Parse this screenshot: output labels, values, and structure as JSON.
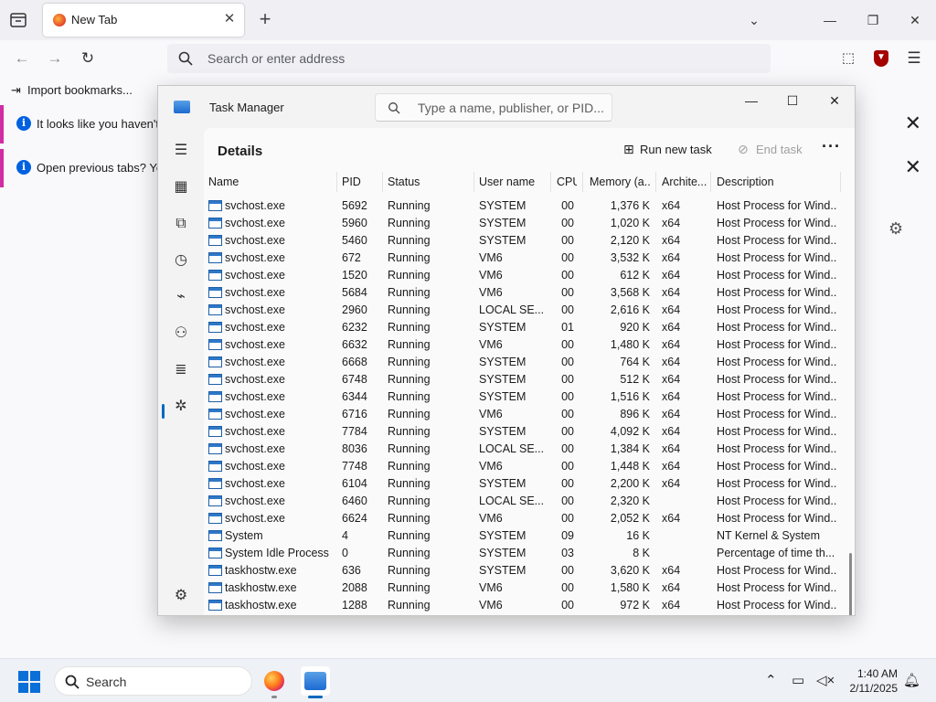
{
  "firefox": {
    "tab_title": "New Tab",
    "url_placeholder": "Search or enter address",
    "bookmark_import": "Import bookmarks...",
    "notice1": "It looks like you haven't s",
    "notice2": "Open previous tabs? You"
  },
  "taskmgr": {
    "app_title": "Task Manager",
    "search_placeholder": "Type a name, publisher, or PID...",
    "section_title": "Details",
    "run_new_task": "Run new task",
    "end_task": "End task",
    "columns": {
      "name": "Name",
      "pid": "PID",
      "status": "Status",
      "user": "User name",
      "cpu": "CPU",
      "mem": "Memory (a...",
      "arch": "Archite...",
      "desc": "Description"
    },
    "rows": [
      {
        "name": "svchost.exe",
        "pid": "5692",
        "status": "Running",
        "user": "SYSTEM",
        "cpu": "00",
        "mem": "1,376 K",
        "arch": "x64",
        "desc": "Host Process for Wind..."
      },
      {
        "name": "svchost.exe",
        "pid": "5960",
        "status": "Running",
        "user": "SYSTEM",
        "cpu": "00",
        "mem": "1,020 K",
        "arch": "x64",
        "desc": "Host Process for Wind..."
      },
      {
        "name": "svchost.exe",
        "pid": "5460",
        "status": "Running",
        "user": "SYSTEM",
        "cpu": "00",
        "mem": "2,120 K",
        "arch": "x64",
        "desc": "Host Process for Wind..."
      },
      {
        "name": "svchost.exe",
        "pid": "672",
        "status": "Running",
        "user": "VM6",
        "cpu": "00",
        "mem": "3,532 K",
        "arch": "x64",
        "desc": "Host Process for Wind..."
      },
      {
        "name": "svchost.exe",
        "pid": "1520",
        "status": "Running",
        "user": "VM6",
        "cpu": "00",
        "mem": "612 K",
        "arch": "x64",
        "desc": "Host Process for Wind..."
      },
      {
        "name": "svchost.exe",
        "pid": "5684",
        "status": "Running",
        "user": "VM6",
        "cpu": "00",
        "mem": "3,568 K",
        "arch": "x64",
        "desc": "Host Process for Wind..."
      },
      {
        "name": "svchost.exe",
        "pid": "2960",
        "status": "Running",
        "user": "LOCAL SE...",
        "cpu": "00",
        "mem": "2,616 K",
        "arch": "x64",
        "desc": "Host Process for Wind..."
      },
      {
        "name": "svchost.exe",
        "pid": "6232",
        "status": "Running",
        "user": "SYSTEM",
        "cpu": "01",
        "mem": "920 K",
        "arch": "x64",
        "desc": "Host Process for Wind..."
      },
      {
        "name": "svchost.exe",
        "pid": "6632",
        "status": "Running",
        "user": "VM6",
        "cpu": "00",
        "mem": "1,480 K",
        "arch": "x64",
        "desc": "Host Process for Wind..."
      },
      {
        "name": "svchost.exe",
        "pid": "6668",
        "status": "Running",
        "user": "SYSTEM",
        "cpu": "00",
        "mem": "764 K",
        "arch": "x64",
        "desc": "Host Process for Wind..."
      },
      {
        "name": "svchost.exe",
        "pid": "6748",
        "status": "Running",
        "user": "SYSTEM",
        "cpu": "00",
        "mem": "512 K",
        "arch": "x64",
        "desc": "Host Process for Wind..."
      },
      {
        "name": "svchost.exe",
        "pid": "6344",
        "status": "Running",
        "user": "SYSTEM",
        "cpu": "00",
        "mem": "1,516 K",
        "arch": "x64",
        "desc": "Host Process for Wind..."
      },
      {
        "name": "svchost.exe",
        "pid": "6716",
        "status": "Running",
        "user": "VM6",
        "cpu": "00",
        "mem": "896 K",
        "arch": "x64",
        "desc": "Host Process for Wind..."
      },
      {
        "name": "svchost.exe",
        "pid": "7784",
        "status": "Running",
        "user": "SYSTEM",
        "cpu": "00",
        "mem": "4,092 K",
        "arch": "x64",
        "desc": "Host Process for Wind..."
      },
      {
        "name": "svchost.exe",
        "pid": "8036",
        "status": "Running",
        "user": "LOCAL SE...",
        "cpu": "00",
        "mem": "1,384 K",
        "arch": "x64",
        "desc": "Host Process for Wind..."
      },
      {
        "name": "svchost.exe",
        "pid": "7748",
        "status": "Running",
        "user": "VM6",
        "cpu": "00",
        "mem": "1,448 K",
        "arch": "x64",
        "desc": "Host Process for Wind..."
      },
      {
        "name": "svchost.exe",
        "pid": "6104",
        "status": "Running",
        "user": "SYSTEM",
        "cpu": "00",
        "mem": "2,200 K",
        "arch": "x64",
        "desc": "Host Process for Wind..."
      },
      {
        "name": "svchost.exe",
        "pid": "6460",
        "status": "Running",
        "user": "LOCAL SE...",
        "cpu": "00",
        "mem": "2,320 K",
        "arch": "",
        "desc": "Host Process for Wind..."
      },
      {
        "name": "svchost.exe",
        "pid": "6624",
        "status": "Running",
        "user": "VM6",
        "cpu": "00",
        "mem": "2,052 K",
        "arch": "x64",
        "desc": "Host Process for Wind..."
      },
      {
        "name": "System",
        "pid": "4",
        "status": "Running",
        "user": "SYSTEM",
        "cpu": "09",
        "mem": "16 K",
        "arch": "",
        "desc": "NT Kernel & System"
      },
      {
        "name": "System Idle Process",
        "pid": "0",
        "status": "Running",
        "user": "SYSTEM",
        "cpu": "03",
        "mem": "8 K",
        "arch": "",
        "desc": "Percentage of time th..."
      },
      {
        "name": "taskhostw.exe",
        "pid": "636",
        "status": "Running",
        "user": "SYSTEM",
        "cpu": "00",
        "mem": "3,620 K",
        "arch": "x64",
        "desc": "Host Process for Wind..."
      },
      {
        "name": "taskhostw.exe",
        "pid": "2088",
        "status": "Running",
        "user": "VM6",
        "cpu": "00",
        "mem": "1,580 K",
        "arch": "x64",
        "desc": "Host Process for Wind..."
      },
      {
        "name": "taskhostw.exe",
        "pid": "1288",
        "status": "Running",
        "user": "VM6",
        "cpu": "00",
        "mem": "972 K",
        "arch": "x64",
        "desc": "Host Process for Wind..."
      }
    ]
  },
  "taskbar": {
    "search_placeholder": "Search",
    "time": "1:40 AM",
    "date": "2/11/2025"
  },
  "colors": {
    "accent": "#0067c0",
    "notice_stripe": "#d12ca3"
  }
}
